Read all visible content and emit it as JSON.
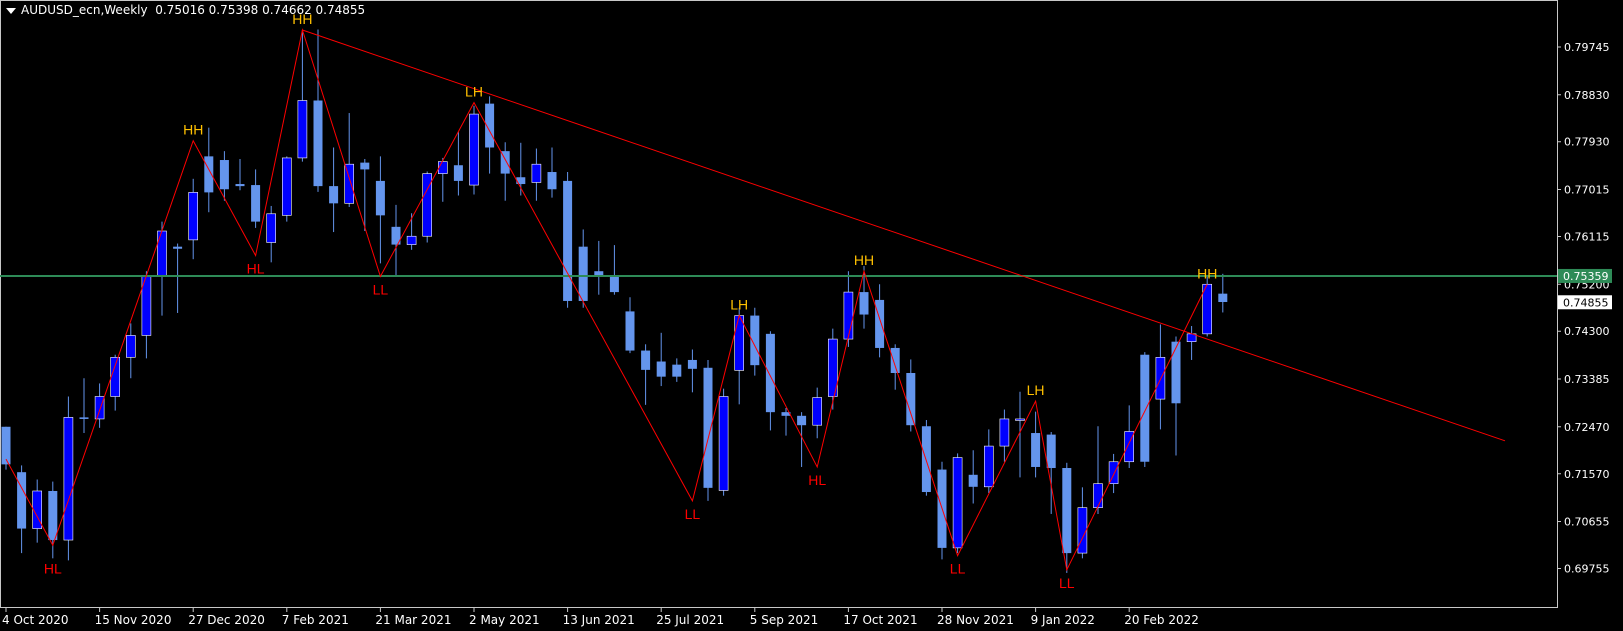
{
  "header": {
    "symbol": "AUDUSD_ecn,Weekly",
    "ohlc": "0.75016 0.75398 0.74662 0.74855"
  },
  "colors": {
    "background": "#000000",
    "axis_text": "#ffffff",
    "frame": "#c8c8c8",
    "bull_candle": "#0000ff",
    "bear_candle": "#6495ed",
    "zigzag": "#ff0000",
    "trendline": "#ff0000",
    "horizontal_level": "#2e8b57",
    "label_high": "#ffc000",
    "label_low": "#ff0000"
  },
  "chart_data": {
    "type": "candlestick",
    "title": "AUDUSD_ecn,Weekly",
    "x_tick_labels": [
      "4 Oct 2020",
      "15 Nov 2020",
      "27 Dec 2020",
      "7 Feb 2021",
      "21 Mar 2021",
      "2 May 2021",
      "13 Jun 2021",
      "25 Jul 2021",
      "5 Sep 2021",
      "17 Oct 2021",
      "28 Nov 2021",
      "9 Jan 2022",
      "20 Feb 2022"
    ],
    "x_tick_index": [
      0,
      6,
      12,
      18,
      24,
      30,
      36,
      42,
      48,
      54,
      60,
      66,
      72
    ],
    "y_ticks": [
      "0.79745",
      "0.78830",
      "0.77930",
      "0.77015",
      "0.76115",
      "0.75200",
      "0.74300",
      "0.73385",
      "0.72470",
      "0.71570",
      "0.70655",
      "0.69755"
    ],
    "ylim": [
      0.6955,
      0.8011
    ],
    "price_tag": "0.74855",
    "level_tag": "0.75359",
    "horizontal_level": 0.75359,
    "candles": [
      {
        "date": "4 Oct 2020",
        "o": 0.7247,
        "h": 0.7247,
        "l": 0.7165,
        "c": 0.7175
      },
      {
        "date": "11 Oct 2020",
        "o": 0.716,
        "h": 0.7173,
        "l": 0.7005,
        "c": 0.7052
      },
      {
        "date": "18 Oct 2020",
        "o": 0.7052,
        "h": 0.7146,
        "l": 0.7025,
        "c": 0.7124
      },
      {
        "date": "25 Oct 2020",
        "o": 0.7124,
        "h": 0.7142,
        "l": 0.6995,
        "c": 0.703
      },
      {
        "date": "1 Nov 2020",
        "o": 0.703,
        "h": 0.7305,
        "l": 0.6991,
        "c": 0.7265
      },
      {
        "date": "8 Nov 2020",
        "o": 0.7265,
        "h": 0.734,
        "l": 0.7235,
        "c": 0.7262
      },
      {
        "date": "15 Nov 2020",
        "o": 0.7262,
        "h": 0.733,
        "l": 0.7245,
        "c": 0.7305
      },
      {
        "date": "22 Nov 2020",
        "o": 0.7305,
        "h": 0.7385,
        "l": 0.7278,
        "c": 0.738
      },
      {
        "date": "29 Nov 2020",
        "o": 0.738,
        "h": 0.7445,
        "l": 0.734,
        "c": 0.7422
      },
      {
        "date": "6 Dec 2020",
        "o": 0.7422,
        "h": 0.7545,
        "l": 0.7378,
        "c": 0.7535
      },
      {
        "date": "13 Dec 2020",
        "o": 0.7535,
        "h": 0.764,
        "l": 0.746,
        "c": 0.7622
      },
      {
        "date": "20 Dec 2020",
        "o": 0.7592,
        "h": 0.7598,
        "l": 0.7465,
        "c": 0.7588
      },
      {
        "date": "27 Dec 2020",
        "o": 0.7605,
        "h": 0.7722,
        "l": 0.7568,
        "c": 0.7696
      },
      {
        "date": "3 Jan 2021",
        "o": 0.7765,
        "h": 0.782,
        "l": 0.7658,
        "c": 0.7696
      },
      {
        "date": "10 Jan 2021",
        "o": 0.7758,
        "h": 0.7775,
        "l": 0.768,
        "c": 0.7702
      },
      {
        "date": "17 Jan 2021",
        "o": 0.7712,
        "h": 0.776,
        "l": 0.77,
        "c": 0.7708
      },
      {
        "date": "24 Jan 2021",
        "o": 0.771,
        "h": 0.774,
        "l": 0.7628,
        "c": 0.764
      },
      {
        "date": "31 Jan 2021",
        "o": 0.76,
        "h": 0.767,
        "l": 0.7562,
        "c": 0.7655
      },
      {
        "date": "7 Feb 2021",
        "o": 0.7652,
        "h": 0.7765,
        "l": 0.764,
        "c": 0.7762
      },
      {
        "date": "14 Feb 2021",
        "o": 0.7762,
        "h": 0.8007,
        "l": 0.7755,
        "c": 0.7872
      },
      {
        "date": "21 Feb 2021",
        "o": 0.7872,
        "h": 0.8008,
        "l": 0.7697,
        "c": 0.7708
      },
      {
        "date": "28 Feb 2021",
        "o": 0.7708,
        "h": 0.7782,
        "l": 0.762,
        "c": 0.7675
      },
      {
        "date": "7 Mar 2021",
        "o": 0.7675,
        "h": 0.7848,
        "l": 0.7668,
        "c": 0.775
      },
      {
        "date": "14 Mar 2021",
        "o": 0.7753,
        "h": 0.776,
        "l": 0.7622,
        "c": 0.774
      },
      {
        "date": "21 Mar 2021",
        "o": 0.7718,
        "h": 0.7765,
        "l": 0.756,
        "c": 0.7652
      },
      {
        "date": "28 Mar 2021",
        "o": 0.763,
        "h": 0.7672,
        "l": 0.7535,
        "c": 0.7596
      },
      {
        "date": "4 Apr 2021",
        "o": 0.7596,
        "h": 0.7656,
        "l": 0.7586,
        "c": 0.7612
      },
      {
        "date": "11 Apr 2021",
        "o": 0.7612,
        "h": 0.7736,
        "l": 0.76,
        "c": 0.7732
      },
      {
        "date": "18 Apr 2021",
        "o": 0.7732,
        "h": 0.7762,
        "l": 0.7678,
        "c": 0.7755
      },
      {
        "date": "25 Apr 2021",
        "o": 0.7748,
        "h": 0.7812,
        "l": 0.769,
        "c": 0.7718
      },
      {
        "date": "2 May 2021",
        "o": 0.771,
        "h": 0.7862,
        "l": 0.7692,
        "c": 0.7846
      },
      {
        "date": "9 May 2021",
        "o": 0.7866,
        "h": 0.788,
        "l": 0.7732,
        "c": 0.7782
      },
      {
        "date": "16 May 2021",
        "o": 0.7775,
        "h": 0.7792,
        "l": 0.768,
        "c": 0.7732
      },
      {
        "date": "23 May 2021",
        "o": 0.7725,
        "h": 0.7791,
        "l": 0.769,
        "c": 0.7712
      },
      {
        "date": "30 May 2021",
        "o": 0.7715,
        "h": 0.778,
        "l": 0.768,
        "c": 0.775
      },
      {
        "date": "6 Jun 2021",
        "o": 0.7735,
        "h": 0.7782,
        "l": 0.7686,
        "c": 0.7702
      },
      {
        "date": "13 Jun 2021",
        "o": 0.7718,
        "h": 0.7735,
        "l": 0.7475,
        "c": 0.7488
      },
      {
        "date": "20 Jun 2021",
        "o": 0.7592,
        "h": 0.7625,
        "l": 0.7475,
        "c": 0.7488
      },
      {
        "date": "27 Jun 2021",
        "o": 0.7545,
        "h": 0.7603,
        "l": 0.75,
        "c": 0.7535
      },
      {
        "date": "4 Jul 2021",
        "o": 0.7535,
        "h": 0.7595,
        "l": 0.75,
        "c": 0.7505
      },
      {
        "date": "11 Jul 2021",
        "o": 0.7468,
        "h": 0.7495,
        "l": 0.7388,
        "c": 0.7393
      },
      {
        "date": "18 Jul 2021",
        "o": 0.7393,
        "h": 0.7405,
        "l": 0.7289,
        "c": 0.7356
      },
      {
        "date": "25 Jul 2021",
        "o": 0.7372,
        "h": 0.7427,
        "l": 0.7325,
        "c": 0.7343
      },
      {
        "date": "1 Aug 2021",
        "o": 0.7366,
        "h": 0.7378,
        "l": 0.7333,
        "c": 0.7343
      },
      {
        "date": "8 Aug 2021",
        "o": 0.7375,
        "h": 0.7395,
        "l": 0.7313,
        "c": 0.7358
      },
      {
        "date": "15 Aug 2021",
        "o": 0.736,
        "h": 0.7375,
        "l": 0.7105,
        "c": 0.713
      },
      {
        "date": "22 Aug 2021",
        "o": 0.7125,
        "h": 0.732,
        "l": 0.7115,
        "c": 0.7305
      },
      {
        "date": "29 Aug 2021",
        "o": 0.7355,
        "h": 0.7475,
        "l": 0.729,
        "c": 0.746
      },
      {
        "date": "5 Sep 2021",
        "o": 0.746,
        "h": 0.7475,
        "l": 0.7345,
        "c": 0.7365
      },
      {
        "date": "12 Sep 2021",
        "o": 0.7425,
        "h": 0.743,
        "l": 0.724,
        "c": 0.7275
      },
      {
        "date": "19 Sep 2021",
        "o": 0.7275,
        "h": 0.7283,
        "l": 0.723,
        "c": 0.7268
      },
      {
        "date": "26 Sep 2021",
        "o": 0.7268,
        "h": 0.7275,
        "l": 0.717,
        "c": 0.725
      },
      {
        "date": "3 Oct 2021",
        "o": 0.725,
        "h": 0.7322,
        "l": 0.7225,
        "c": 0.7303
      },
      {
        "date": "10 Oct 2021",
        "o": 0.7305,
        "h": 0.7435,
        "l": 0.728,
        "c": 0.7415
      },
      {
        "date": "17 Oct 2021",
        "o": 0.7415,
        "h": 0.7545,
        "l": 0.74,
        "c": 0.7505
      },
      {
        "date": "24 Oct 2021",
        "o": 0.7505,
        "h": 0.7555,
        "l": 0.7435,
        "c": 0.7462
      },
      {
        "date": "31 Oct 2021",
        "o": 0.749,
        "h": 0.752,
        "l": 0.738,
        "c": 0.7398
      },
      {
        "date": "7 Nov 2021",
        "o": 0.7398,
        "h": 0.7405,
        "l": 0.7318,
        "c": 0.735
      },
      {
        "date": "14 Nov 2021",
        "o": 0.735,
        "h": 0.7376,
        "l": 0.7238,
        "c": 0.725
      },
      {
        "date": "21 Nov 2021",
        "o": 0.7248,
        "h": 0.726,
        "l": 0.7115,
        "c": 0.7122
      },
      {
        "date": "28 Nov 2021",
        "o": 0.7165,
        "h": 0.718,
        "l": 0.6993,
        "c": 0.7015
      },
      {
        "date": "5 Dec 2021",
        "o": 0.7015,
        "h": 0.7196,
        "l": 0.7005,
        "c": 0.7188
      },
      {
        "date": "12 Dec 2021",
        "o": 0.7155,
        "h": 0.7202,
        "l": 0.71,
        "c": 0.7132
      },
      {
        "date": "19 Dec 2021",
        "o": 0.7132,
        "h": 0.7242,
        "l": 0.712,
        "c": 0.721
      },
      {
        "date": "26 Dec 2021",
        "o": 0.721,
        "h": 0.728,
        "l": 0.718,
        "c": 0.7262
      },
      {
        "date": "2 Jan 2022",
        "o": 0.7262,
        "h": 0.7314,
        "l": 0.715,
        "c": 0.7262
      },
      {
        "date": "9 Jan 2022",
        "o": 0.7235,
        "h": 0.7276,
        "l": 0.715,
        "c": 0.717
      },
      {
        "date": "16 Jan 2022",
        "o": 0.7232,
        "h": 0.7237,
        "l": 0.708,
        "c": 0.7168
      },
      {
        "date": "23 Jan 2022",
        "o": 0.7168,
        "h": 0.7178,
        "l": 0.6967,
        "c": 0.7005
      },
      {
        "date": "30 Jan 2022",
        "o": 0.7005,
        "h": 0.7131,
        "l": 0.6995,
        "c": 0.7092
      },
      {
        "date": "6 Feb 2022",
        "o": 0.7092,
        "h": 0.7248,
        "l": 0.708,
        "c": 0.7138
      },
      {
        "date": "13 Feb 2022",
        "o": 0.7138,
        "h": 0.7195,
        "l": 0.712,
        "c": 0.718
      },
      {
        "date": "20 Feb 2022",
        "o": 0.718,
        "h": 0.7288,
        "l": 0.7168,
        "c": 0.7238
      },
      {
        "date": "27 Feb 2022",
        "o": 0.7385,
        "h": 0.739,
        "l": 0.717,
        "c": 0.718
      },
      {
        "date": "6 Mar 2022",
        "o": 0.73,
        "h": 0.7443,
        "l": 0.7242,
        "c": 0.738
      },
      {
        "date": "13 Mar 2022",
        "o": 0.741,
        "h": 0.742,
        "l": 0.7192,
        "c": 0.7292
      },
      {
        "date": "20 Mar 2022",
        "o": 0.741,
        "h": 0.744,
        "l": 0.7375,
        "c": 0.7425
      },
      {
        "date": "27 Mar 2022",
        "o": 0.7425,
        "h": 0.7535,
        "l": 0.742,
        "c": 0.752
      },
      {
        "date": "3 Apr 2022",
        "o": 0.7502,
        "h": 0.754,
        "l": 0.7466,
        "c": 0.7486
      }
    ],
    "zigzag": [
      {
        "i": 0,
        "p": 0.7185
      },
      {
        "i": 3,
        "p": 0.702
      },
      {
        "i": 12,
        "p": 0.7795,
        "label": "HH"
      },
      {
        "i": 16,
        "p": 0.7575,
        "label": "HL"
      },
      {
        "i": 19,
        "p": 0.8007,
        "label": "HH"
      },
      {
        "i": 24,
        "p": 0.7535,
        "label": "LL"
      },
      {
        "i": 30,
        "p": 0.7868,
        "label": "LH"
      },
      {
        "i": 44,
        "p": 0.7105,
        "label": "LL"
      },
      {
        "i": 47,
        "p": 0.746,
        "label": "LH"
      },
      {
        "i": 52,
        "p": 0.717,
        "label": "HL"
      },
      {
        "i": 55,
        "p": 0.7545,
        "label": "HH"
      },
      {
        "i": 61,
        "p": 0.7,
        "label": "LL"
      },
      {
        "i": 66,
        "p": 0.7296,
        "label": "LH"
      },
      {
        "i": 68,
        "p": 0.6973,
        "label": "LL"
      },
      {
        "i": 77,
        "p": 0.752,
        "label": "HH"
      }
    ],
    "extra_labels": [
      {
        "i": 3,
        "p": 0.7,
        "label": "HL"
      }
    ],
    "trendline": {
      "from": {
        "i": 19,
        "p": 0.8007
      },
      "to": {
        "i": 77,
        "p": 0.7415
      },
      "extend_to_edge": true
    }
  }
}
